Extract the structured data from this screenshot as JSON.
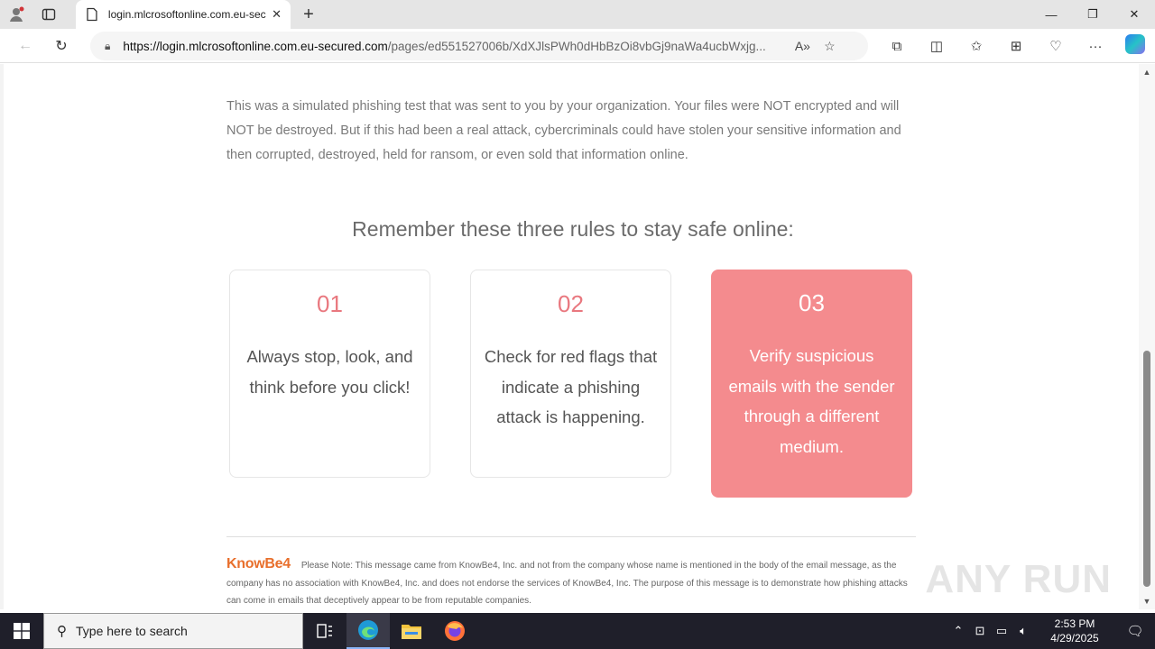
{
  "browser": {
    "tab_title": "login.mlcrosoftonline.com.eu-secured.com",
    "url_host": "https://login.mlcrosoftonline.com.eu-secured.com",
    "url_path": "/pages/ed551527006b/XdXJlsPWh0dHbBzOi8vbGj9naWa4ucbWxjg..."
  },
  "page": {
    "intro": "This was a simulated phishing test that was sent to you by your organization. Your files were NOT encrypted and will NOT be destroyed. But if this had been a real attack, cybercriminals could have stolen your sensitive information and then corrupted, destroyed, held for ransom, or even sold that information online.",
    "rules_title": "Remember these three rules to stay safe online:",
    "rules": [
      {
        "num": "01",
        "text": "Always stop, look, and think before you click!"
      },
      {
        "num": "02",
        "text": "Check for red flags that indicate a phishing attack is happening."
      },
      {
        "num": "03",
        "text": "Verify suspicious emails with the sender through a different medium."
      }
    ],
    "footer_logo": "KnowBe4",
    "footer_note": "Please Note: This message came from KnowBe4, Inc. and not from the company whose name is mentioned in the body of the email message, as the company has no association with KnowBe4, Inc. and does not endorse the services of KnowBe4, Inc. The purpose of this message is to demonstrate how phishing attacks can come in emails that deceptively appear to be from reputable companies.",
    "watermark": "ANY RUN"
  },
  "taskbar": {
    "search_placeholder": "Type here to search",
    "time": "2:53 PM",
    "date": "4/29/2025"
  },
  "colors": {
    "accent_pink": "#f48b8e",
    "number_pink": "#e9787f",
    "knowbe4_orange": "#e86f2c"
  }
}
